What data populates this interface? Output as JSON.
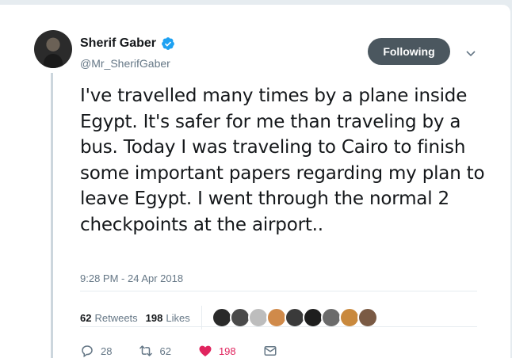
{
  "author": {
    "display_name": "Sherif Gaber",
    "handle": "@Mr_SherifGaber",
    "verified": true
  },
  "follow_button": {
    "label": "Following"
  },
  "tweet": {
    "text": "I've travelled many times by a plane inside Egypt. It's safer for me than traveling by a bus. Today I was traveling to Cairo to finish some important papers regarding my plan to leave Egypt. I went through the normal 2 checkpoints at the airport..",
    "timestamp": "9:28 PM - 24 Apr 2018"
  },
  "stats": {
    "retweets_count": "62",
    "retweets_label": "Retweets",
    "likes_count": "198",
    "likes_label": "Likes",
    "liker_avatar_colors": [
      "#2a2a2a",
      "#4a4a4a",
      "#bdbdbd",
      "#d08a4a",
      "#3a3a3a",
      "#1e1e1e",
      "#6b6b6b",
      "#c9893d",
      "#7a5a44"
    ]
  },
  "actions": {
    "reply_count": "28",
    "retweet_count": "62",
    "like_count": "198"
  },
  "colors": {
    "text_primary": "#14171a",
    "text_secondary": "#657786",
    "verified_blue": "#1da1f2",
    "like_red": "#e0245e",
    "following_button": "#4b575f"
  }
}
